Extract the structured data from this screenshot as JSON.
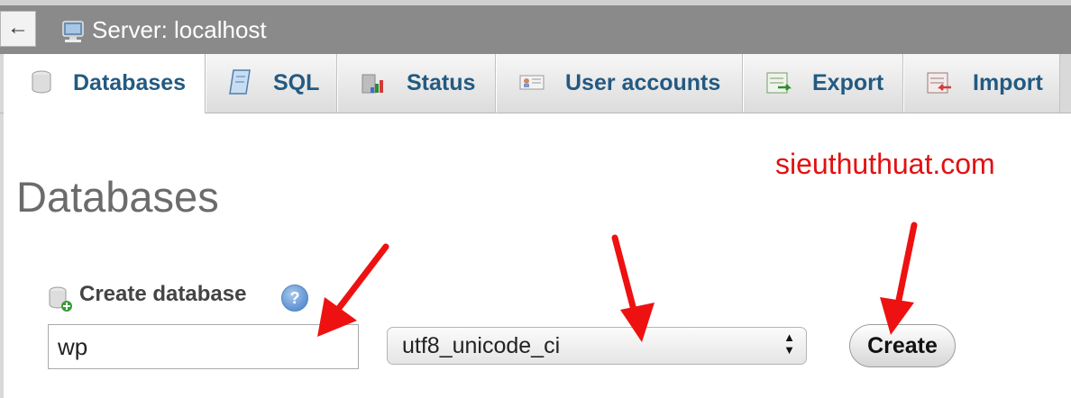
{
  "header": {
    "back_glyph": "←",
    "server_title": "Server: localhost",
    "server_icon": "server-icon"
  },
  "tabs": [
    {
      "label": "Databases",
      "icon": "database-icon",
      "active": true
    },
    {
      "label": "SQL",
      "icon": "sql-icon",
      "active": false
    },
    {
      "label": "Status",
      "icon": "status-icon",
      "active": false
    },
    {
      "label": "User accounts",
      "icon": "user-accounts-icon",
      "active": false
    },
    {
      "label": "Export",
      "icon": "export-icon",
      "active": false
    },
    {
      "label": "Import",
      "icon": "import-icon",
      "active": false
    }
  ],
  "main": {
    "title": "Databases",
    "watermark": "sieuthuthuat.com",
    "create": {
      "label": "Create database",
      "help_glyph": "?",
      "name_value": "wp",
      "collation_value": "utf8_unicode_ci",
      "button_label": "Create"
    }
  },
  "colors": {
    "tab_text": "#235a81",
    "annotation_arrow": "#ee1111",
    "watermark": "#e21111"
  }
}
